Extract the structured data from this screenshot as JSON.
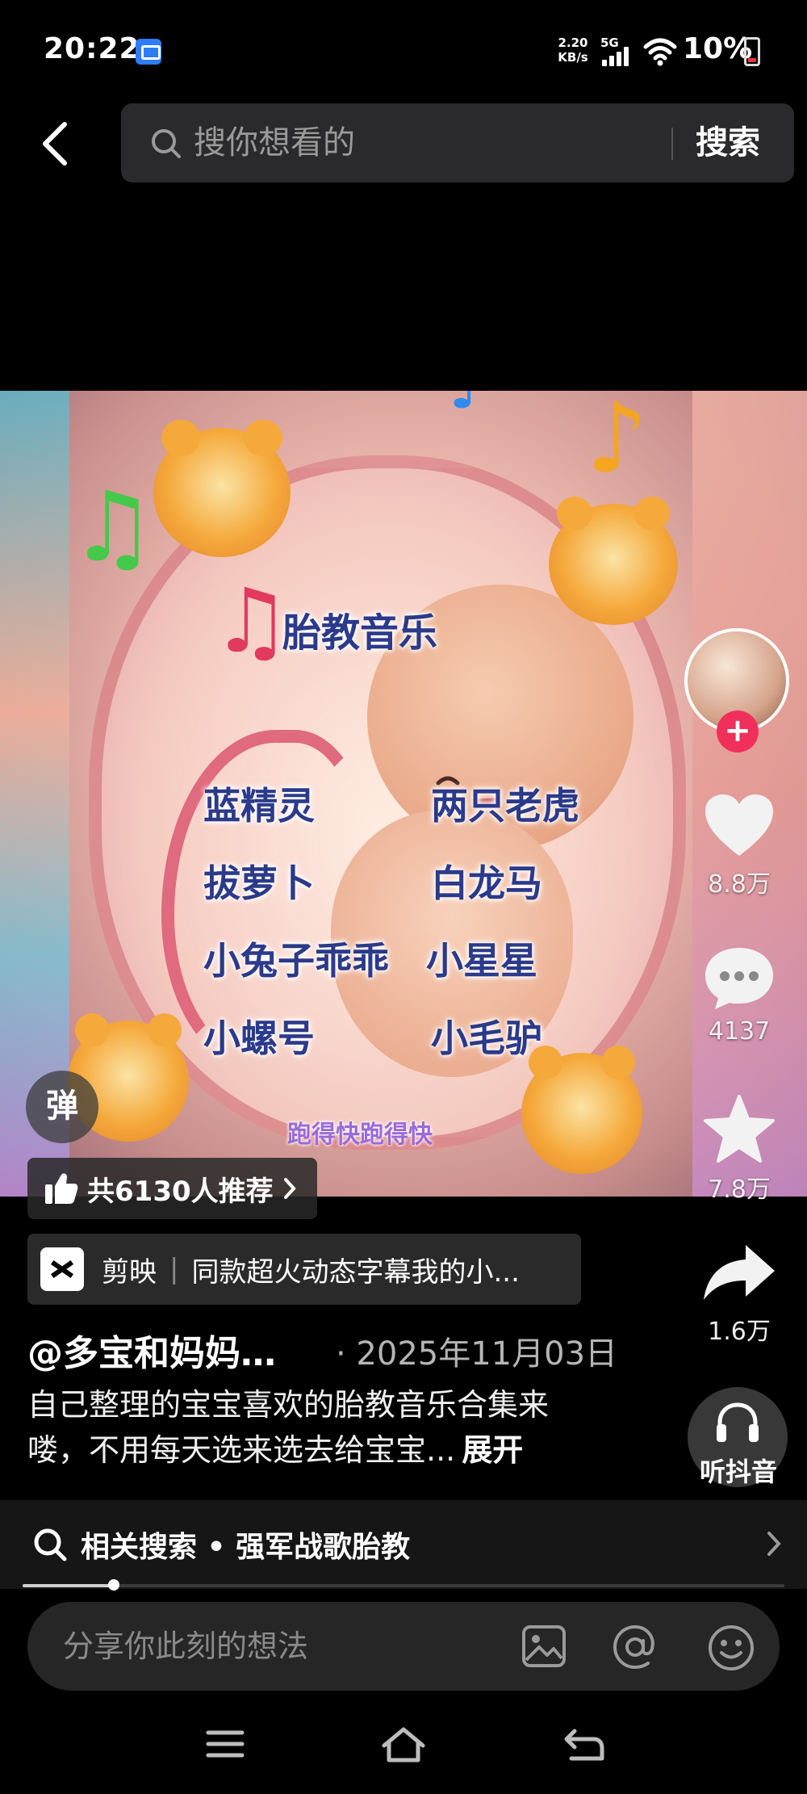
{
  "status_bar": {
    "time": "20:22",
    "net_speed_value": "2.20",
    "net_speed_unit": "KB/s",
    "network": "5G",
    "battery": "10%"
  },
  "header": {
    "search_placeholder": "搜你想看的",
    "search_button": "搜索"
  },
  "video": {
    "title": "胎教音乐",
    "songs": [
      "蓝精灵",
      "两只老虎",
      "拔萝卜",
      "白龙马",
      "小兔子乖乖",
      "小星星",
      "小螺号",
      "小毛驴"
    ],
    "caption": "跑得快跑得快"
  },
  "actions": {
    "likes": "8.8万",
    "comments": "4137",
    "favorites": "7.8万",
    "shares": "1.6万",
    "listen_label": "听抖音"
  },
  "danmu_label": "弹",
  "recommend": "共6130人推荐",
  "capcut": {
    "app": "剪映",
    "text": "同款超火动态字幕我的小..."
  },
  "post": {
    "author": "@多宝和妈妈…",
    "date": "· 2025年11月03日",
    "description": "自己整理的宝宝喜欢的胎教音乐合集来喽，不用每天选来选去给宝宝...",
    "expand": "展开"
  },
  "related_search": {
    "text": "相关搜索 • 强军战歌胎教"
  },
  "playback_progress": 0.12,
  "comment_bar": {
    "placeholder": "分享你此刻的想法"
  },
  "icons": [
    "back-arrow-icon",
    "search-icon",
    "heart-icon",
    "comment-icon",
    "star-icon",
    "share-icon",
    "headphones-icon",
    "image-icon",
    "at-icon",
    "emoji-icon",
    "thumbs-up-icon",
    "chevron-right-icon",
    "menu-icon",
    "home-icon",
    "back-icon"
  ],
  "colors": {
    "background": "#000000",
    "follow_red": "#f0305b",
    "search_bg": "#2a2a2c"
  }
}
